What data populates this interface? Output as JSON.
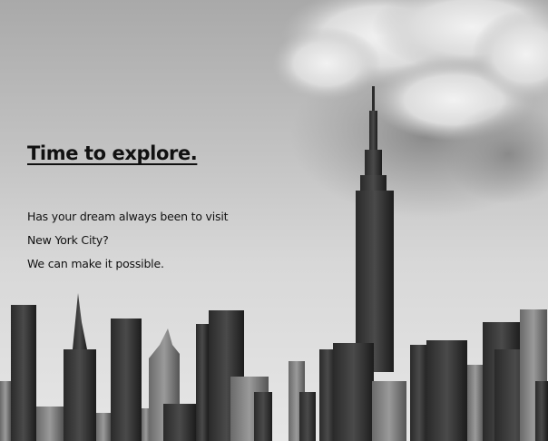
{
  "hero": {
    "headline": "Time to explore.",
    "body_lines": [
      "Has your dream always been to visit",
      "New York City?",
      "We can make it possible."
    ],
    "image_icon": "city-skyline-photo"
  },
  "colors": {
    "sky_top": "#a9a9a9",
    "sky_bottom": "#e6e6e6",
    "text": "#111111",
    "buildings": "#1f1f1f"
  }
}
